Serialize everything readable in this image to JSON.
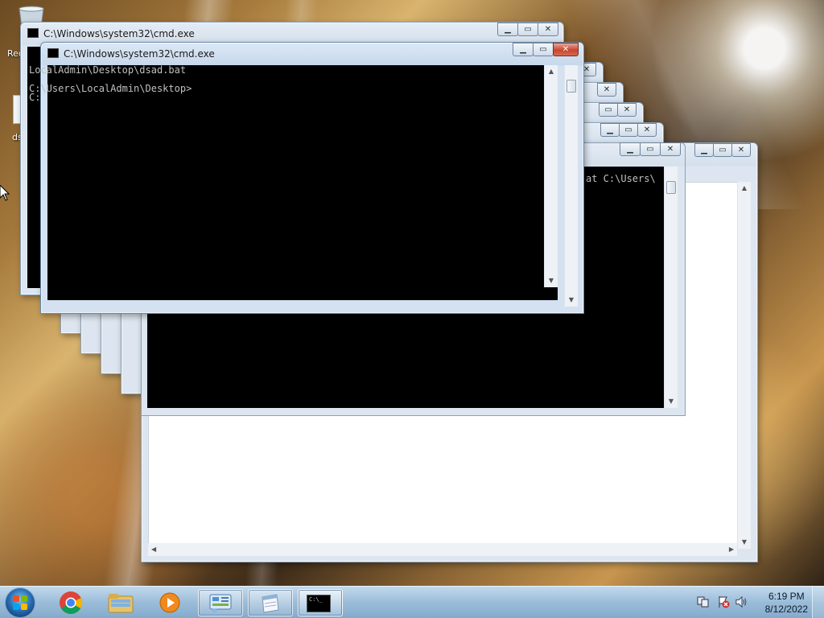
{
  "desktop": {
    "recycle_bin_label": "Rec",
    "file_label": "ds"
  },
  "windows": {
    "front": {
      "title": "C:\\Windows\\system32\\cmd.exe",
      "console_lines": [
        "C:",
        "LocalAdmin\\Desktop\\dsad.bat",
        "",
        "C:\\Users\\LocalAdmin\\Desktop>"
      ]
    },
    "back": {
      "title": "C:\\Windows\\system32\\cmd.exe",
      "console_lines": [
        "C:",
        "LocalAdmin\\Desktop\\dsad.bat",
        "",
        "C:\\Users\\LocalAdmin\\Desktop>"
      ]
    },
    "middle": {
      "console_text": "at C:\\Users\\"
    }
  },
  "controls": {
    "minimize_glyph": "▁",
    "maximize_glyph": "▭",
    "close_glyph": "✕"
  },
  "taskbar": {
    "pinned": [
      "start-button",
      "chrome",
      "explorer",
      "media-player",
      "control-panel",
      "notepad",
      "cmd"
    ],
    "cmd_icon_text": "C:\\_",
    "clock": {
      "time": "6:19 PM",
      "date": "8/12/2022"
    }
  }
}
